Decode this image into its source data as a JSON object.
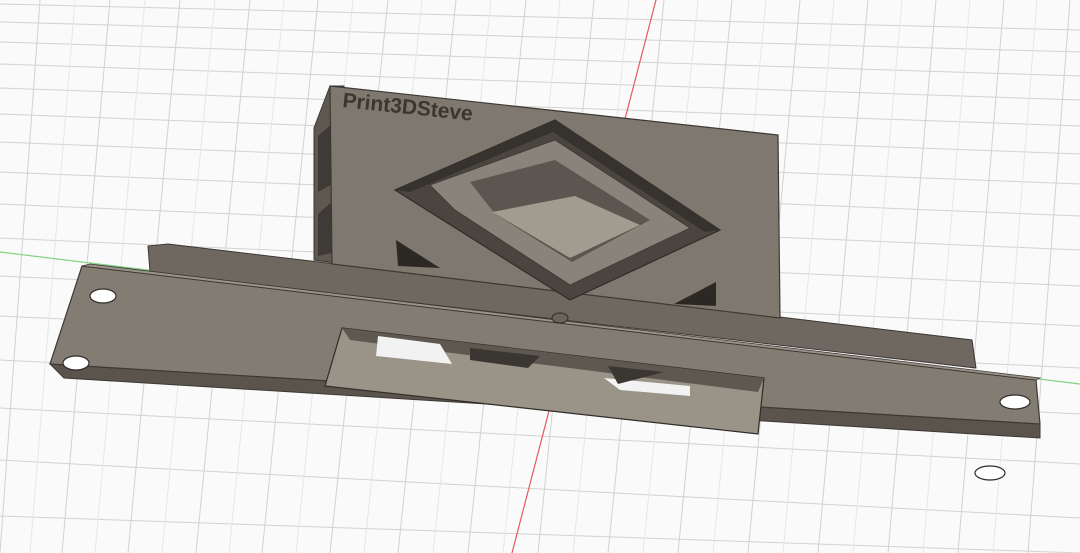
{
  "viewport": {
    "background": "#fafafa",
    "grid_color": "#cfcfcf",
    "x_axis_color": "#e35a5a",
    "y_axis_color": "#6ccf6c"
  },
  "model": {
    "embossed_text": "Print3DSteve",
    "body_color": "#7a736a",
    "face_color": "#857d73",
    "shadow_color": "#4a453f"
  }
}
